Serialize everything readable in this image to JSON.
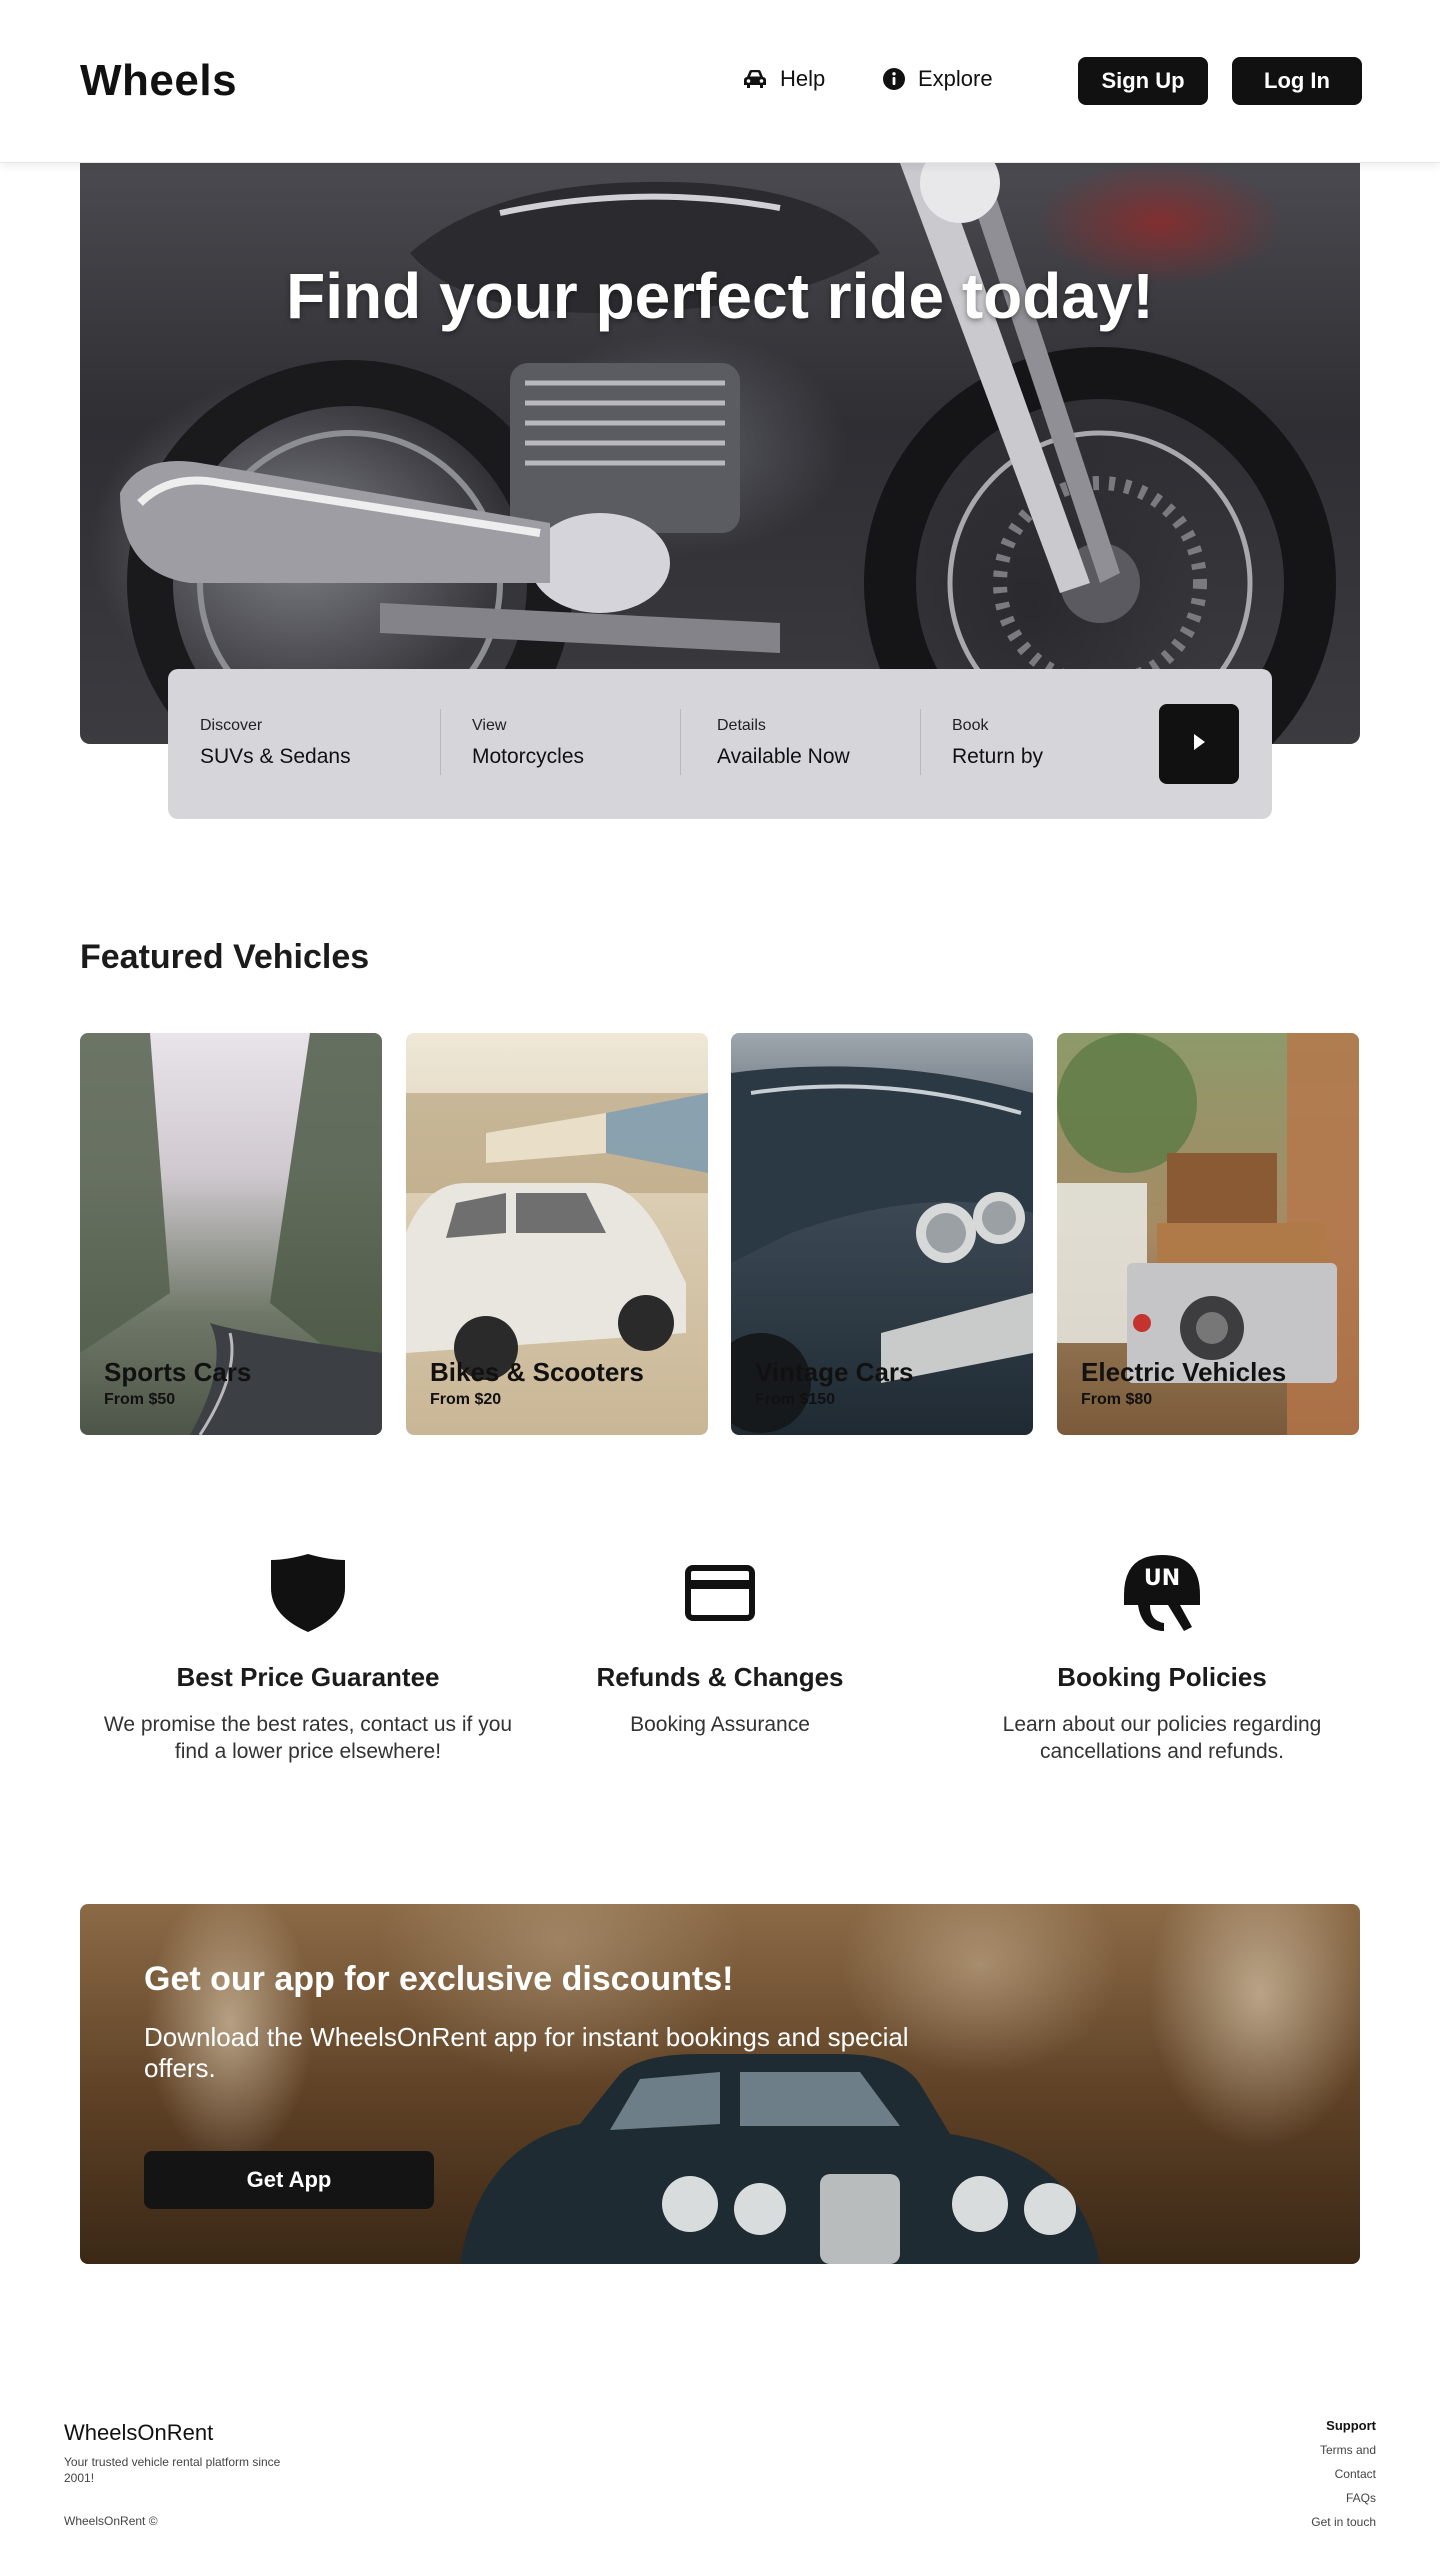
{
  "header": {
    "logo": "Wheels",
    "nav": [
      {
        "label": "Help",
        "icon": "car-icon"
      },
      {
        "label": "Explore",
        "icon": "info-icon"
      }
    ],
    "signup_label": "Sign Up",
    "login_label": "Log In"
  },
  "hero": {
    "title": "Find your perfect ride today!"
  },
  "search": {
    "fields": [
      {
        "label": "Discover",
        "value": "SUVs & Sedans"
      },
      {
        "label": "View",
        "value": "Motorcycles"
      },
      {
        "label": "Details",
        "value": "Available Now"
      },
      {
        "label": "Book",
        "value": "Return by"
      }
    ],
    "submit_icon": "play-arrow-icon"
  },
  "featured": {
    "title": "Featured Vehicles",
    "cards": [
      {
        "name": "Sports Cars",
        "price": "From $50"
      },
      {
        "name": "Bikes & Scooters",
        "price": "From $20"
      },
      {
        "name": "Vintage Cars",
        "price": "From $150"
      },
      {
        "name": "Electric Vehicles",
        "price": "From $80"
      }
    ]
  },
  "features": [
    {
      "icon": "shield-icon",
      "title": "Best Price Guarantee",
      "text": "We promise the best rates, contact us if you find a lower price elsewhere!"
    },
    {
      "icon": "credit-card-icon",
      "title": "Refunds & Changes",
      "text": "Booking Assurance"
    },
    {
      "icon": "helmet-icon",
      "title": "Booking Policies",
      "text": "Learn about our policies regarding cancellations and refunds."
    }
  ],
  "promo": {
    "title": "Get our app for exclusive discounts!",
    "subtitle": "Download the WheelsOnRent app for instant bookings and special offers.",
    "button_label": "Get App"
  },
  "footer": {
    "brand": "WheelsOnRent",
    "tagline": "Your trusted vehicle rental platform since 2001!",
    "copyright": "WheelsOnRent ©",
    "support_title": "Support",
    "links": [
      "Terms and",
      "Contact",
      "FAQs",
      "Get in touch"
    ]
  },
  "colors": {
    "primary_button": "#111111",
    "search_panel": "#d6d5da"
  }
}
